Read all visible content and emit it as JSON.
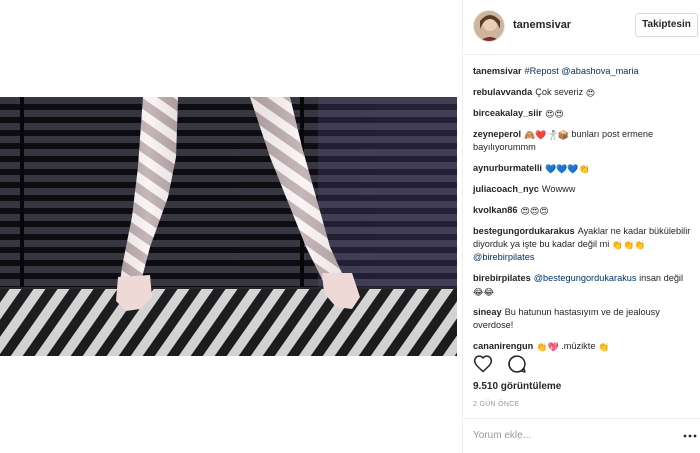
{
  "header": {
    "username": "tanemsivar",
    "follow_label": "Takiptesin"
  },
  "caption": {
    "user": "tanemsivar",
    "text": "#Repost @abashova_maria"
  },
  "comments": [
    {
      "user": "rebulavvanda",
      "text": "Çok severiz",
      "emoji": "😍"
    },
    {
      "user": "birceakalay_siir",
      "text": "",
      "emoji": "😍😍"
    },
    {
      "user": "zeyneperol",
      "text": "bunları post ermene bayılıyorummm",
      "emoji": "🙈❤️🤺📦"
    },
    {
      "user": "aynurburmatelli",
      "text": "",
      "emoji": "💙💙💙👏"
    },
    {
      "user": "juliacoach_nyc",
      "text": "Wowww",
      "emoji": ""
    },
    {
      "user": "kvolkan86",
      "text": "",
      "emoji": "😍😍😍"
    },
    {
      "user": "bestegungordukarakus",
      "text": "Ayaklar ne kadar bükülebilir diyorduk ya işte bu kadar değil mi",
      "mention": "@birebirpilates",
      "emoji": "👏👏👏"
    },
    {
      "user": "birebirpilates",
      "text": "insan değil",
      "mention": "@bestegungordukarakus",
      "emoji": "😂😂"
    },
    {
      "user": "sineay",
      "text": "Bu hatunun hastasıyım ve de jealousy overdose!",
      "emoji": ""
    },
    {
      "user": "cananirengun",
      "text": ".müzikte",
      "emoji": "👏💖",
      "emoji_after": "👏"
    }
  ],
  "actions": {
    "like_icon": "heart-icon",
    "comment_icon": "comment-icon"
  },
  "stats": {
    "views": "9.510 görüntüleme",
    "age": "2 GÜN ÖNCE"
  },
  "add_comment": {
    "placeholder": "Yorum ekle..."
  },
  "colors": {
    "link": "#003569",
    "border": "#efefef",
    "muted": "#999999",
    "media_bg": "#0e0e12"
  }
}
